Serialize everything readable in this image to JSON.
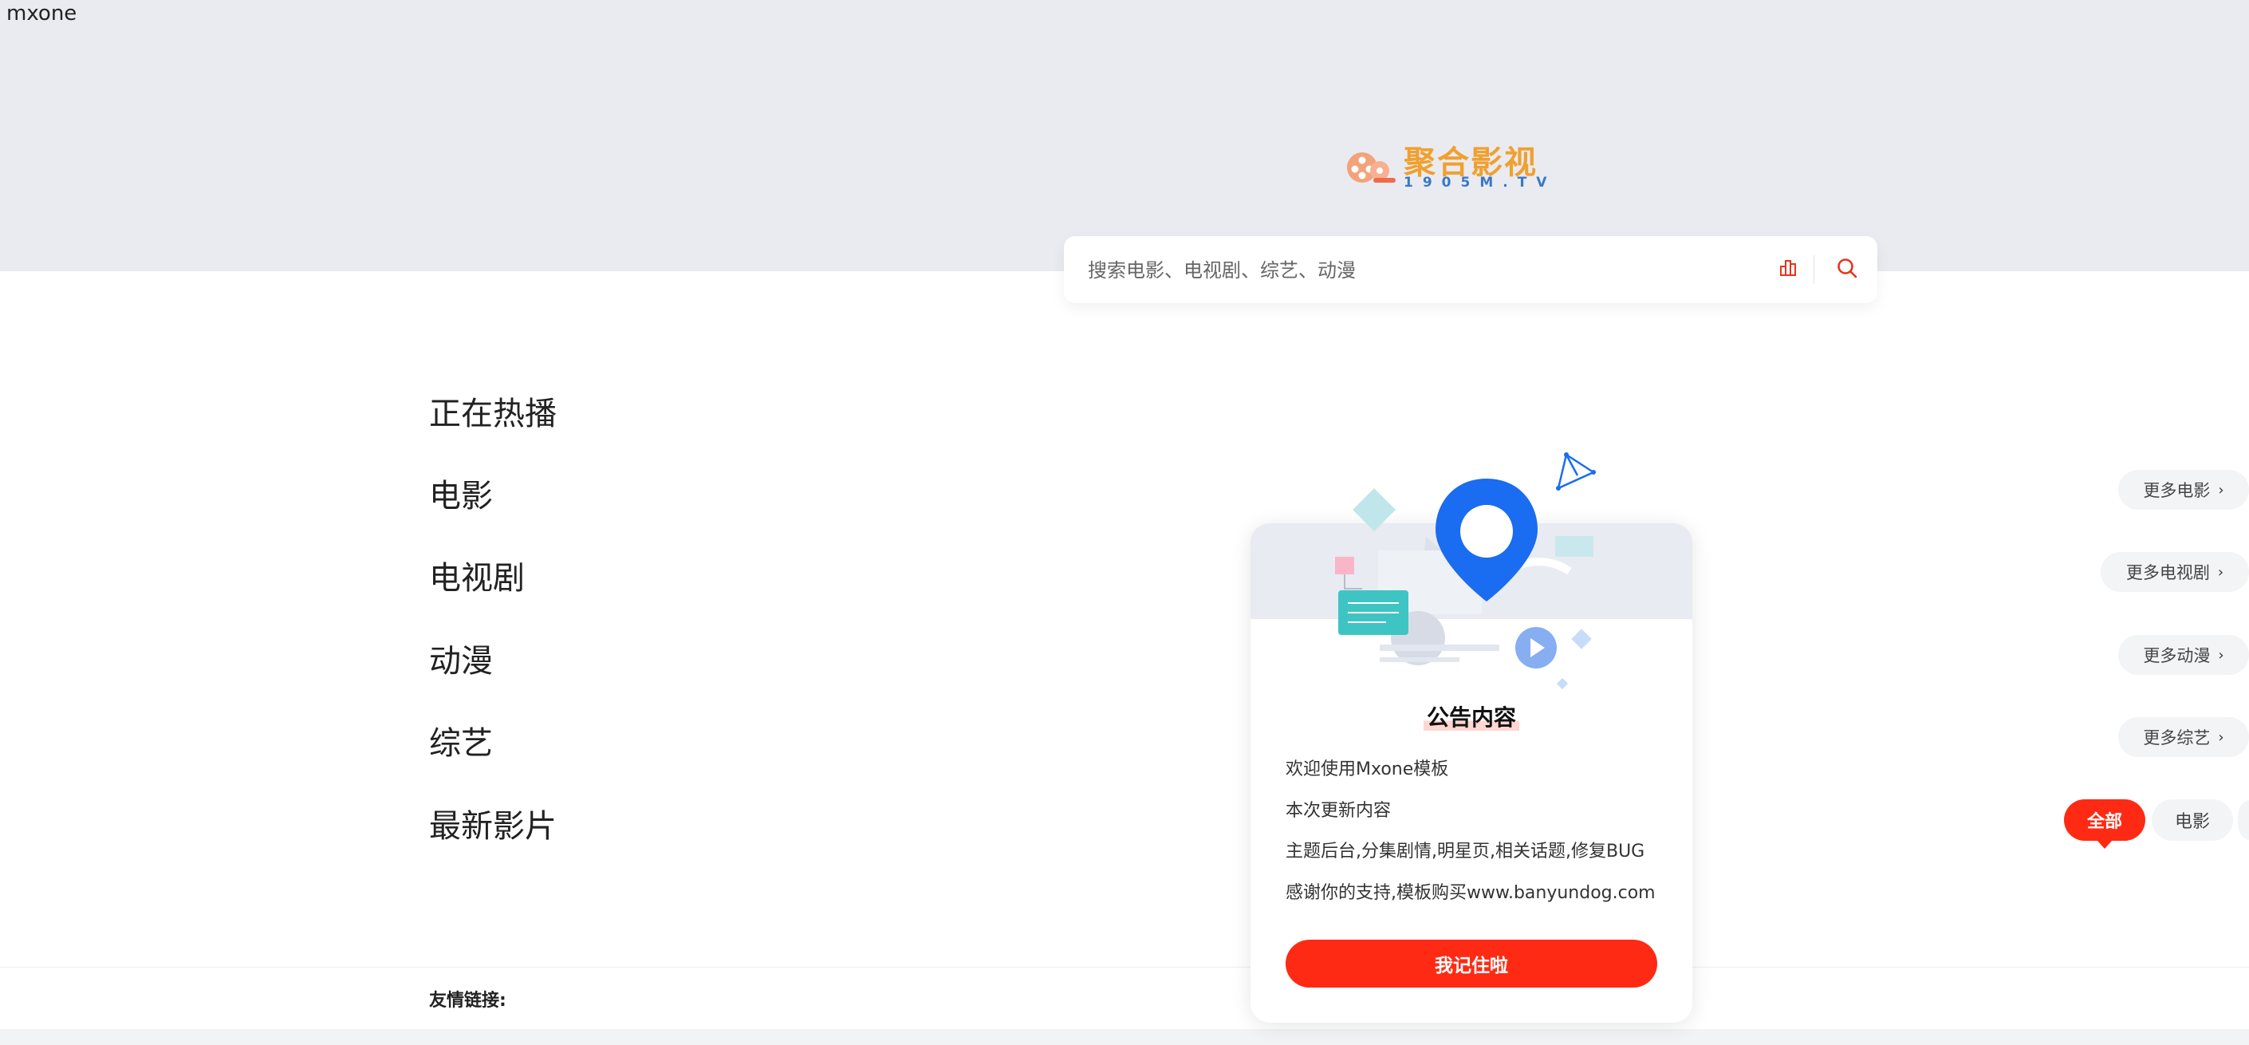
{
  "site": {
    "name": "mxone"
  },
  "logo": {
    "main": "聚合影视",
    "sub": "1905M.TV"
  },
  "search": {
    "placeholder": "搜索电影、电视剧、综艺、动漫",
    "value": ""
  },
  "sections": [
    {
      "title": "正在热播"
    },
    {
      "title": "电影",
      "more": "更多电影"
    },
    {
      "title": "电视剧",
      "more": "更多电视剧"
    },
    {
      "title": "动漫",
      "more": "更多动漫"
    },
    {
      "title": "综艺",
      "more": "更多综艺"
    },
    {
      "title": "最新影片"
    }
  ],
  "filters": {
    "all": "全部",
    "movie": "电影"
  },
  "footer": {
    "friend_links": "友情链接:"
  },
  "notice": {
    "title": "公告内容",
    "lines": [
      "欢迎使用Mxone模板",
      "本次更新内容",
      "主题后台,分集剧情,明星页,相关话题,修复BUG",
      "感谢你的支持,模板购买www.banyundog.com"
    ],
    "button": "我记住啦"
  },
  "colors": {
    "accent": "#ff2a14",
    "hero_bg": "#e9ebf0",
    "pin_blue": "#1a6cf0",
    "logo_orange": "#f0a030",
    "logo_blue": "#3a78c8"
  },
  "icons": {
    "rank": "ranking-icon",
    "search": "search-icon",
    "chevron": "chevron-right-icon",
    "reel": "film-reel-icon",
    "pin": "location-pin-icon"
  }
}
